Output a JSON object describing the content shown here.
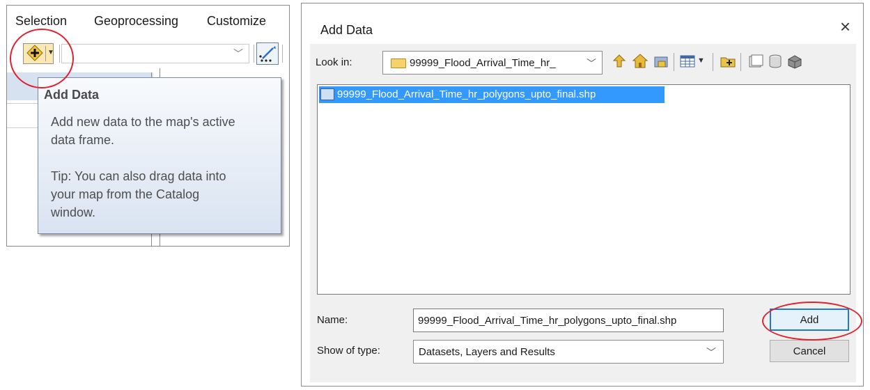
{
  "left_panel": {
    "menu": [
      "Selection",
      "Geoprocessing",
      "Customize"
    ],
    "tooltip": {
      "title": "Add Data",
      "body": "Add new data to the map's active\ndata frame.\n\nTip: You can also drag data into\nyour map from the Catalog\nwindow."
    },
    "icons": {
      "add_data": "add-data-plus-icon",
      "edit": "editor-sketch-icon"
    }
  },
  "dialog": {
    "title": "Add Data",
    "close_glyph": "×",
    "look_in_label": "Look in:",
    "look_in_value": "99999_Flood_Arrival_Time_hr_",
    "files": [
      "99999_Flood_Arrival_Time_hr_polygons_upto_final.shp"
    ],
    "name_label": "Name:",
    "name_value": "99999_Flood_Arrival_Time_hr_polygons_upto_final.shp",
    "type_label": "Show of type:",
    "type_value": "Datasets, Layers and Results",
    "add_label": "Add",
    "cancel_label": "Cancel"
  },
  "colors": {
    "selection": "#3399ff",
    "annotation": "#e0212c",
    "tooltip_bg": "#dfe7f3",
    "add_button_highlight": "#e5f1fb",
    "add_data_button": "#fbe8b3"
  }
}
